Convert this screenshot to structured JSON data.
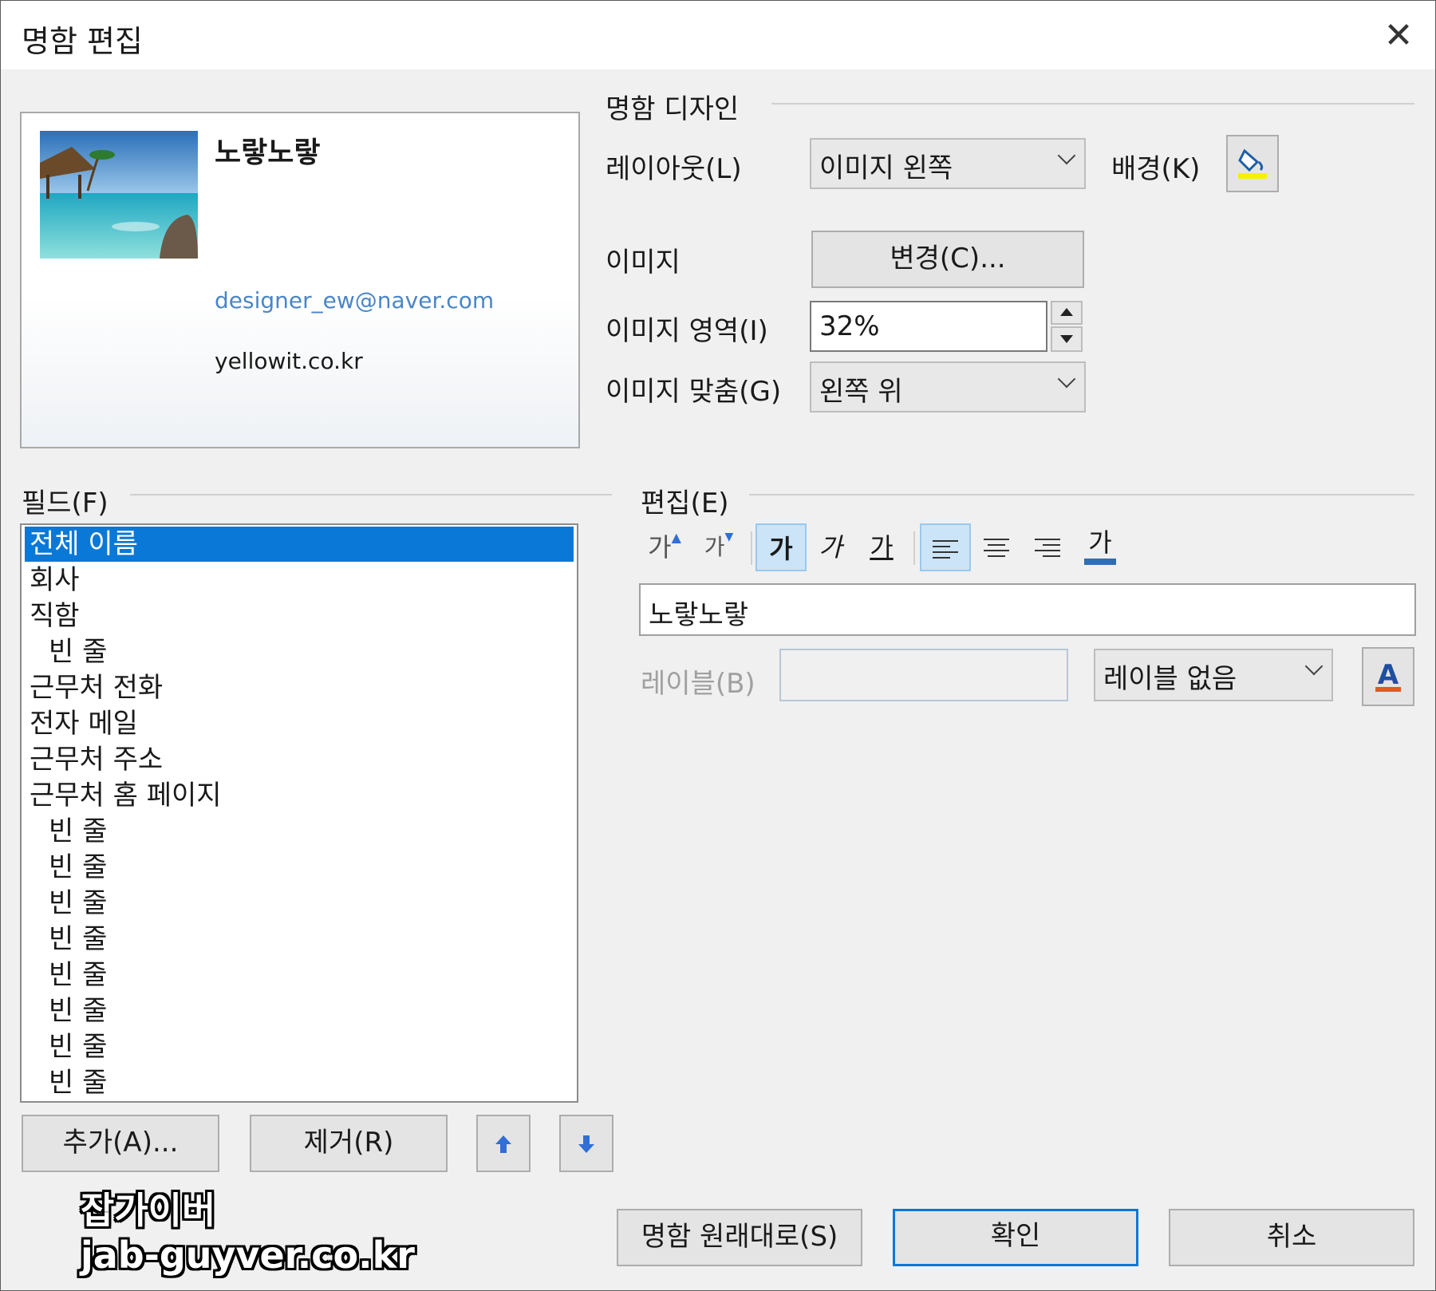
{
  "window": {
    "title": "명함 편집",
    "close_glyph": "✕"
  },
  "preview": {
    "name": "노랗노랗",
    "email": "designer_ew@naver.com",
    "website": "yellowit.co.kr"
  },
  "design": {
    "section_label": "명함 디자인",
    "layout_label": "레이아웃(L)",
    "layout_value": "이미지 왼쪽",
    "background_label": "배경(K)",
    "image_label": "이미지",
    "change_button": "변경(C)...",
    "image_area_label": "이미지 영역(I)",
    "image_area_value": "32%",
    "image_align_label": "이미지 맞춤(G)",
    "image_align_value": "왼쪽 위"
  },
  "fields": {
    "section_label": "필드(F)",
    "items": [
      {
        "label": "전체 이름",
        "indent": false,
        "selected": true
      },
      {
        "label": "회사",
        "indent": false
      },
      {
        "label": "직함",
        "indent": false
      },
      {
        "label": "빈 줄",
        "indent": true
      },
      {
        "label": "근무처 전화",
        "indent": false
      },
      {
        "label": "전자 메일",
        "indent": false
      },
      {
        "label": "근무처 주소",
        "indent": false
      },
      {
        "label": "근무처 홈 페이지",
        "indent": false
      },
      {
        "label": "빈 줄",
        "indent": true
      },
      {
        "label": "빈 줄",
        "indent": true
      },
      {
        "label": "빈 줄",
        "indent": true
      },
      {
        "label": "빈 줄",
        "indent": true
      },
      {
        "label": "빈 줄",
        "indent": true
      },
      {
        "label": "빈 줄",
        "indent": true
      },
      {
        "label": "빈 줄",
        "indent": true
      },
      {
        "label": "빈 줄",
        "indent": true
      }
    ],
    "add_button": "추가(A)...",
    "remove_button": "제거(R)"
  },
  "edit": {
    "section_label": "편집(E)",
    "toolbar": {
      "grow_font": "가",
      "shrink_font": "가",
      "bold": "가",
      "italic": "가",
      "underline": "가",
      "font_color": "가"
    },
    "text_value": "노랗노랗",
    "label_label": "레이블(B)",
    "label_value": "",
    "label_position": "레이블 없음"
  },
  "footer": {
    "reset_button": "명함 원래대로(S)",
    "ok_button": "확인",
    "cancel_button": "취소"
  },
  "watermark": {
    "line1": "잡가이버",
    "line2": "jab-guyver.co.kr"
  },
  "colors": {
    "selection": "#0a78d7",
    "email_link": "#4a86c8",
    "toggle_on": "#cce4f7"
  }
}
